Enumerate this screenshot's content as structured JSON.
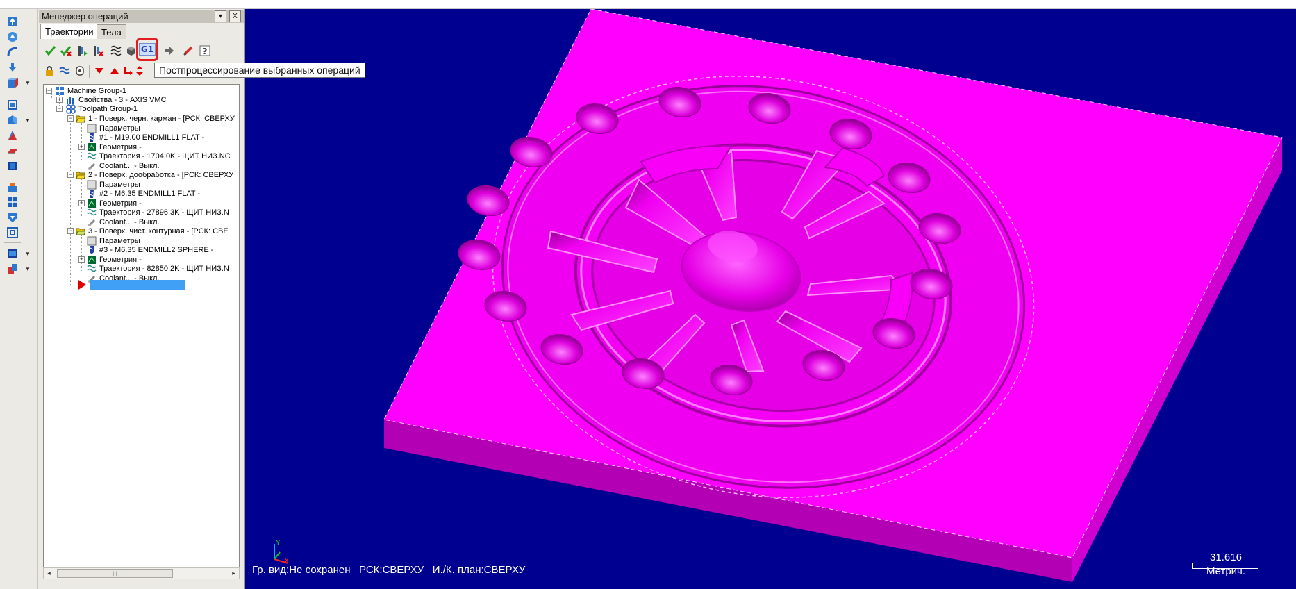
{
  "panel": {
    "title": "Менеджер операций",
    "menu_glyph": "▾",
    "close_glyph": "X",
    "tabs": [
      {
        "label": "Траектории",
        "active": true
      },
      {
        "label": "Тела",
        "active": false
      }
    ],
    "postprocess_button_label": "G1"
  },
  "tooltip": {
    "text": "Постпроцессирование выбранных операций"
  },
  "tree": {
    "machine_group": "Machine Group-1",
    "properties": "Свойства - 3 - AXIS VMC",
    "toolpath_group": "Toolpath Group-1",
    "operations": [
      {
        "title": "1 - Поверх. черн. карман - [РСК: СВЕРХУ",
        "params": "Параметры",
        "tool": "#1 - M19.00 ENDMILL1 FLAT -",
        "geometry": "Геометрия -",
        "toolpath": "Траектория - 1704.0K - ЩИТ НИЗ.NC",
        "coolant": "Coolant... - Выкл."
      },
      {
        "title": "2 - Поверх. дообработка - [РСК: СВЕРХУ",
        "params": "Параметры",
        "tool": "#2 - M6.35 ENDMILL1 FLAT -",
        "geometry": "Геометрия -",
        "toolpath": "Траектория - 27896.3K - ЩИТ НИЗ.N",
        "coolant": "Coolant... - Выкл."
      },
      {
        "title": "3 - Поверх. чист. контурная - [РСК: СВЕ",
        "params": "Параметры",
        "tool": "#3 - M6.35 ENDMILL2 SPHERE -",
        "geometry": "Геометрия -",
        "toolpath": "Траектория - 82850.2K - ЩИТ НИЗ.N",
        "coolant": "Coolant... - Выкл."
      }
    ]
  },
  "scrollbar": {
    "left_arrow": "◂",
    "right_arrow": "▸",
    "thumb_grip": "III"
  },
  "viewport": {
    "status_line": "Гр. вид:Не сохранен   РСК:СВЕРХУ   И./К. план:СВЕРХУ",
    "scale_value": "31.616",
    "scale_unit": "Метрич.",
    "axis_y": "Y",
    "axis_x": "X"
  },
  "colors": {
    "viewport_bg": "#000090",
    "part_top": "#ff00ff",
    "part_side_front": "#b400b4",
    "part_side_right": "#d000d0",
    "tooltip_highlight": "#e02020",
    "insert_marker": "#3fa0f5"
  }
}
